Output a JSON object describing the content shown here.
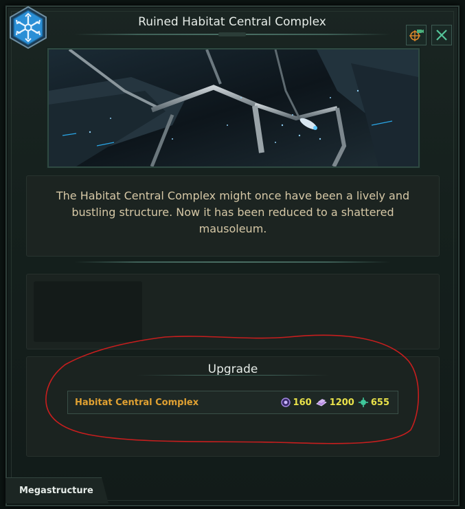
{
  "window": {
    "title": "Ruined Habitat Central Complex",
    "description": "The Habitat Central Complex might once have been a lively and bustling structure. Now it has been reduced to a shattered mausoleum."
  },
  "buttons": {
    "camera_icon": "camera-crosshair-icon",
    "close_icon": "close-icon"
  },
  "upgrade": {
    "heading": "Upgrade",
    "option": {
      "name": "Habitat Central Complex",
      "costs": [
        {
          "icon": "influence-icon",
          "value": "160",
          "color": "#9a7ad8"
        },
        {
          "icon": "alloys-icon",
          "value": "1200",
          "color": "#b58be0"
        },
        {
          "icon": "unity-icon",
          "value": "655",
          "color": "#3fc79a"
        }
      ]
    }
  },
  "footer": {
    "tab_label": "Megastructure"
  },
  "colors": {
    "accent": "#e0a132",
    "value": "#e9e24a",
    "annotation": "#c81e1e",
    "emblem": "#2b8fd6"
  }
}
